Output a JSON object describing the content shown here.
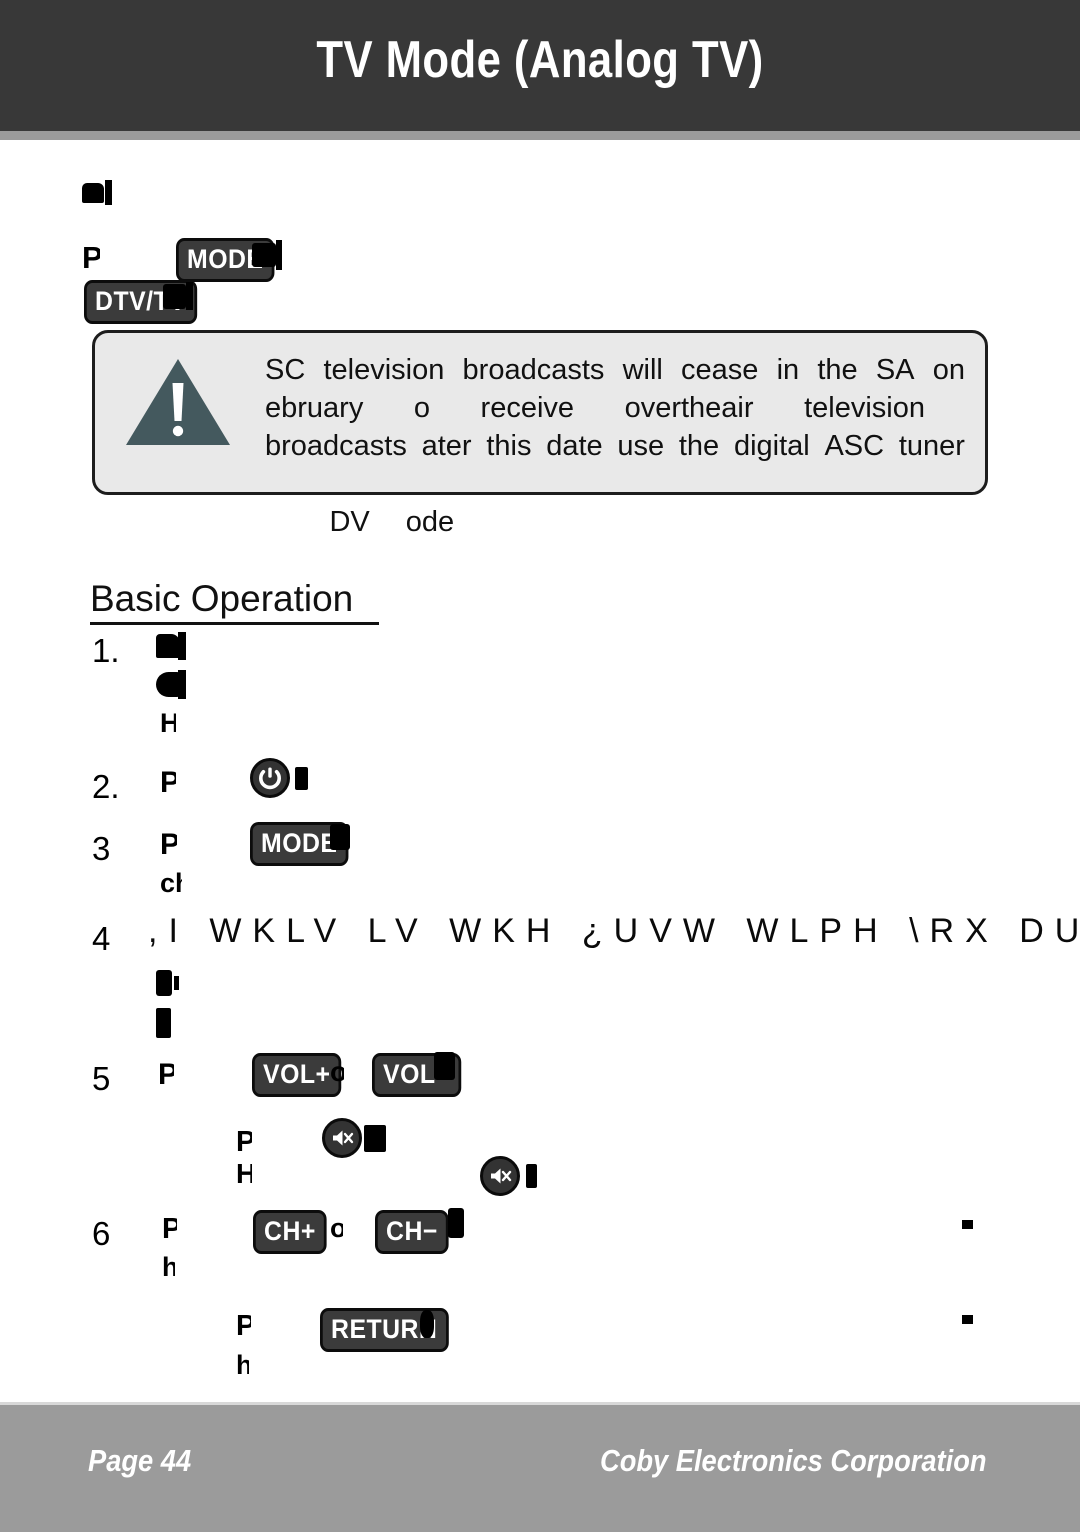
{
  "header": {
    "title": "TV Mode (Analog TV)"
  },
  "intro": {
    "fragments": [
      {
        "label": "intro-blob-1"
      },
      {
        "label": "intro-blob-2"
      }
    ],
    "badges": [
      {
        "label": "MODE"
      },
      {
        "label": "DTV/TV"
      }
    ]
  },
  "note": {
    "icon": "warning-triangle-icon",
    "lines": [
      "SC       television   broadcasts   will  cease  in the  SA    on",
      "ebruary                        o  receive   overtheair      television",
      "broadcasts    ater  this date  use  the digital  ASC    tuner",
      "DV     ode"
    ],
    "line_words": [
      [
        "SC",
        "television",
        "broadcasts",
        "will",
        "cease",
        "in",
        "the",
        "SA",
        "on"
      ],
      [
        "ebruary",
        "o",
        "receive",
        "overtheair",
        "television"
      ],
      [
        "broadcasts",
        "ater",
        "this",
        "date",
        "use",
        "the",
        "digital",
        "ASC",
        "tuner"
      ],
      [
        "DV",
        "ode"
      ]
    ]
  },
  "section": {
    "heading": "Basic Operation"
  },
  "steps": [
    {
      "number": "1.",
      "badges": [],
      "icons": [],
      "garbled": ""
    },
    {
      "number": "2.",
      "badges": [],
      "icons": [
        "power-icon"
      ],
      "garbled": ""
    },
    {
      "number": "3",
      "badges": [
        "MODE"
      ],
      "icons": [],
      "garbled": ""
    },
    {
      "number": "4",
      "badges": [],
      "icons": [],
      "garbled": ",I  WKLV  LV  WKH  ¿UVW  WLPH  \\RX  DUH  XV"
    },
    {
      "number": "5",
      "badges": [
        "VOL+",
        "VOL−"
      ],
      "icons": [
        "mute-icon",
        "mute-icon"
      ],
      "garbled": ""
    },
    {
      "number": "6",
      "badges": [
        "CH+",
        "CH−",
        "RETURN"
      ],
      "icons": [],
      "garbled": ""
    }
  ],
  "footer": {
    "page_label": "Page 44",
    "company": "Coby Electronics Corporation"
  },
  "colors": {
    "header_bg": "#383838",
    "rule": "#9b9b9b",
    "note_bg": "#e9e9e9",
    "note_border": "#1d1d1d",
    "warning_triangle": "#44595e",
    "badge_bg": "#3b3b3b",
    "badge_border": "#0c0c0c",
    "footer_bg": "#9b9b9b",
    "text": "#000000"
  }
}
